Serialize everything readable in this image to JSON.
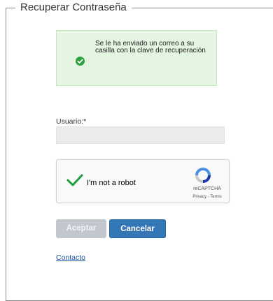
{
  "form": {
    "legend": "Recuperar Contraseña",
    "alert": {
      "message": "Se le ha enviado un correo a su casilla con la clave de recuperación",
      "icon": "check-circle-icon",
      "color": "#2ea13d"
    },
    "username": {
      "label": "Usuario:*",
      "value": "",
      "placeholder": ""
    },
    "recaptcha": {
      "checkbox_label": "I'm not a robot",
      "checked": true,
      "brand": "reCAPTCHA",
      "links": "Privacy - Terms"
    },
    "buttons": {
      "accept": "Aceptar",
      "cancel": "Cancelar"
    },
    "contact_link": "Contacto"
  },
  "colors": {
    "primary_button": "#3477b6",
    "disabled_button": "#c2c7ce",
    "alert_background": "#e4f5e1",
    "link": "#1a4f9c"
  }
}
